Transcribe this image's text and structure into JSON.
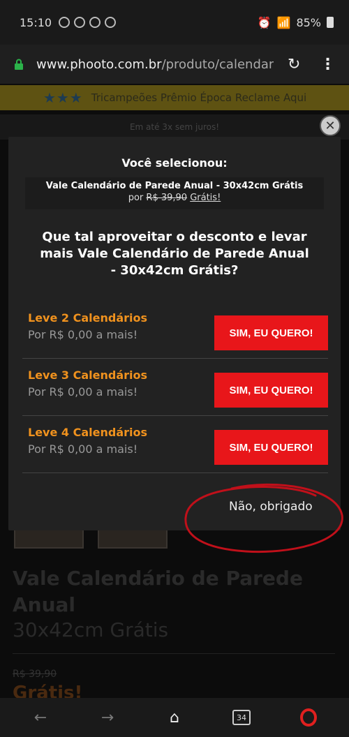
{
  "status": {
    "time": "15:10",
    "battery": "85%"
  },
  "browser": {
    "url_domain": "www.phooto.com.br",
    "url_path": "/produto/calendari"
  },
  "page": {
    "banner_text": "Tricampeões Prêmio Época Reclame Aqui",
    "subline": "Em até 3x sem juros!",
    "product_title": "Vale Calendário de Parede Anual",
    "product_subtitle": "30x42cm Grátis",
    "old_price": "R$ 39,90",
    "free": "Grátis!"
  },
  "modal": {
    "selected_label": "Você selecionou:",
    "selected_product": "Vale Calendário de Parede Anual - 30x42cm Grátis",
    "price_prefix": "por",
    "old_price": "R$ 39,90",
    "new_price": "Grátis!",
    "question": "Que tal aproveitar o desconto e levar mais Vale Calendário de Parede Anual - 30x42cm Grátis?",
    "offers": [
      {
        "title": "Leve 2 Calendários",
        "price": "Por R$ 0,00 a mais!",
        "button": "SIM, EU QUERO!"
      },
      {
        "title": "Leve 3 Calendários",
        "price": "Por R$ 0,00 a mais!",
        "button": "SIM, EU QUERO!"
      },
      {
        "title": "Leve 4 Calendários",
        "price": "Por R$ 0,00 a mais!",
        "button": "SIM, EU QUERO!"
      }
    ],
    "decline": "Não, obrigado"
  },
  "bottom_nav": {
    "tabs_count": "34"
  },
  "colors": {
    "accent_orange": "#f0921e",
    "cta_red": "#e8161a",
    "annotation_red": "#c0101a"
  }
}
